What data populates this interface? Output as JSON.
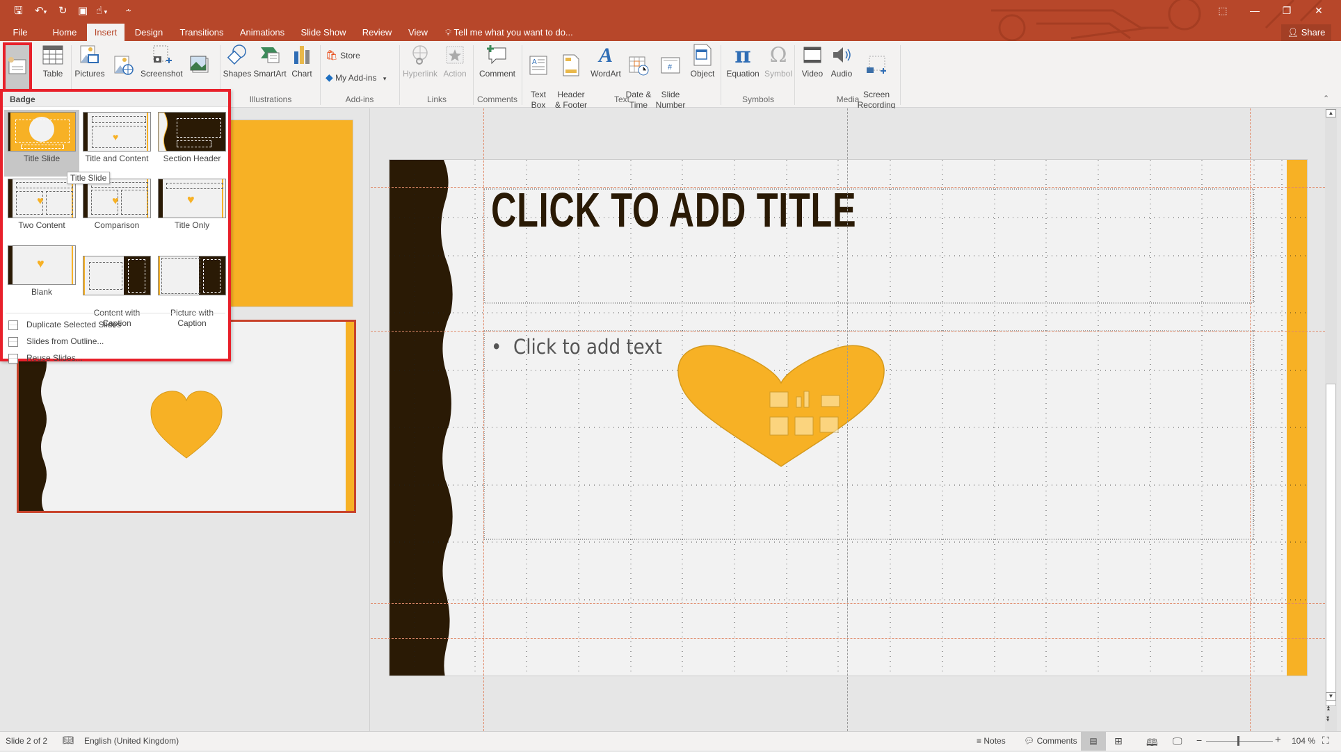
{
  "quick_access": {
    "save": "save-icon",
    "undo": "undo-icon",
    "redo": "redo-icon",
    "present": "present-from-start-icon",
    "touch": "touch-mode-icon",
    "customize": "customize-qat-icon"
  },
  "tabs": [
    {
      "label": "File"
    },
    {
      "label": "Home"
    },
    {
      "label": "Insert",
      "active": true
    },
    {
      "label": "Design"
    },
    {
      "label": "Transitions"
    },
    {
      "label": "Animations"
    },
    {
      "label": "Slide Show"
    },
    {
      "label": "Review"
    },
    {
      "label": "View"
    }
  ],
  "tell_me": "Tell me what you want to do...",
  "share_label": "Share",
  "ribbon": {
    "buttons": {
      "new_slide": "New\nSlide",
      "table": "Table",
      "pictures": "Pictures",
      "online_pictures": "Online\nPictures",
      "screenshot": "Screenshot",
      "photo_album": "Photo\nAlbum",
      "shapes": "Shapes",
      "smartart": "SmartArt",
      "chart": "Chart",
      "store": "Store",
      "my_addins": "My Add-ins",
      "hyperlink": "Hyperlink",
      "action": "Action",
      "comment": "Comment",
      "text_box": "Text\nBox",
      "header_footer": "Header\n& Footer",
      "wordart": "WordArt",
      "date_time": "Date &\nTime",
      "slide_number": "Slide\nNumber",
      "object": "Object",
      "equation": "Equation",
      "symbol": "Symbol",
      "video": "Video",
      "audio": "Audio",
      "screen_recording": "Screen\nRecording"
    },
    "groups": {
      "illustrations": "Illustrations",
      "addins": "Add-ins",
      "links": "Links",
      "comments": "Comments",
      "text": "Text",
      "symbols": "Symbols",
      "media": "Media"
    }
  },
  "layout_gallery": {
    "theme_name": "Badge",
    "layouts": [
      {
        "label": "Title Slide",
        "selected": true
      },
      {
        "label": "Title and Content"
      },
      {
        "label": "Section Header"
      },
      {
        "label": "Two Content"
      },
      {
        "label": "Comparison"
      },
      {
        "label": "Title Only"
      },
      {
        "label": "Blank"
      },
      {
        "label": "Content with\nCaption"
      },
      {
        "label": "Picture with\nCaption"
      }
    ],
    "tooltip": "Title Slide",
    "menu": [
      {
        "label": "Duplicate Selected Slides"
      },
      {
        "label": "Slides from Outline..."
      },
      {
        "label": "Reuse Slides..."
      }
    ]
  },
  "slide": {
    "title_placeholder": "CLICK TO ADD TITLE",
    "body_placeholder": "Click to add text",
    "colors": {
      "dark": "#2a1a05",
      "accent": "#f7b125",
      "background": "#f2f2f2"
    }
  },
  "status": {
    "slide_indicator": "Slide 2 of 2",
    "language": "English (United Kingdom)",
    "notes": "Notes",
    "comments": "Comments",
    "zoom": "104 %",
    "zoom_level_percent": 104
  },
  "theme": {
    "brand": "#b7472a",
    "highlight_border": "#e8202a"
  }
}
